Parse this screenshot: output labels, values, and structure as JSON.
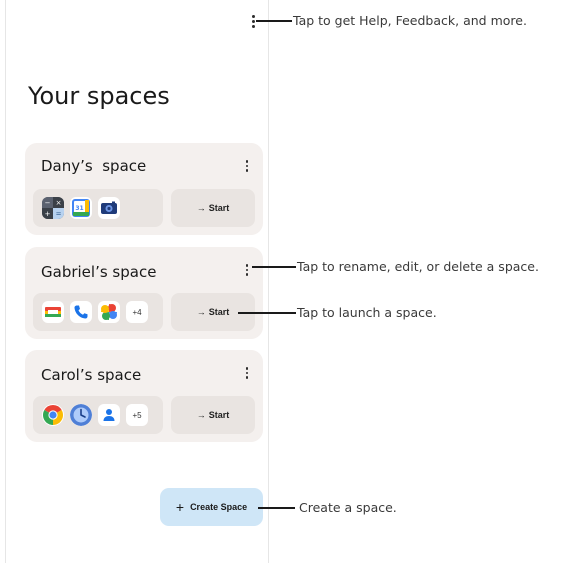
{
  "header": {
    "title": "Your spaces"
  },
  "spaces": [
    {
      "name": "Dany’s  space",
      "start_label": "Start",
      "apps": [
        "calculator-icon",
        "calendar-icon",
        "camera-icon"
      ],
      "extra_count": ""
    },
    {
      "name": "Gabriel’s space",
      "start_label": "Start",
      "apps": [
        "google-meet-icon",
        "phone-icon",
        "google-photos-icon"
      ],
      "extra_count": "+4"
    },
    {
      "name": "Carol’s space",
      "start_label": "Start",
      "apps": [
        "chrome-icon",
        "clock-icon",
        "contacts-icon"
      ],
      "extra_count": "+5"
    }
  ],
  "fab": {
    "label": "Create Space"
  },
  "callouts": {
    "menu": "Tap to get Help, Feedback, and more.",
    "space_menu": "Tap to rename, edit, or delete a space.",
    "launch": "Tap to launch a space.",
    "create": "Create a space."
  },
  "colors": {
    "card_bg": "#f4f0ee",
    "pill_bg": "#e9e4e1",
    "fab_bg": "#cfe6f7"
  }
}
